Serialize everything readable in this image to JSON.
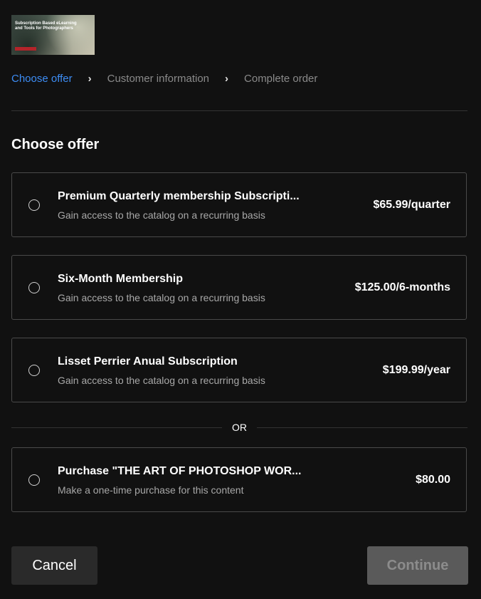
{
  "thumbnail": {
    "text": "Subscription Based eLearning and Tools for Photographers"
  },
  "steps": [
    {
      "label": "Choose offer",
      "active": true
    },
    {
      "label": "Customer information",
      "active": false
    },
    {
      "label": "Complete order",
      "active": false
    }
  ],
  "heading": "Choose offer",
  "offers": [
    {
      "title": "Premium Quarterly membership Subscripti...",
      "description": "Gain access to the catalog on a recurring basis",
      "price": "$65.99/quarter",
      "selected": false
    },
    {
      "title": "Six-Month Membership",
      "description": "Gain access to the catalog on a recurring basis",
      "price": "$125.00/6-months",
      "selected": false
    },
    {
      "title": "Lisset Perrier Anual Subscription",
      "description": "Gain access to the catalog on a recurring basis",
      "price": "$199.99/year",
      "selected": false
    }
  ],
  "separator": "OR",
  "purchase": {
    "title": "Purchase \"THE ART OF PHOTOSHOP WOR...",
    "description": "Make a one-time purchase for this content",
    "price": "$80.00",
    "selected": false
  },
  "buttons": {
    "cancel": "Cancel",
    "continue": "Continue",
    "continue_disabled": true
  },
  "colors": {
    "background": "#111111",
    "accent": "#3d8df5",
    "border": "#4a4a4a",
    "muted_text": "#a8a8a8"
  }
}
